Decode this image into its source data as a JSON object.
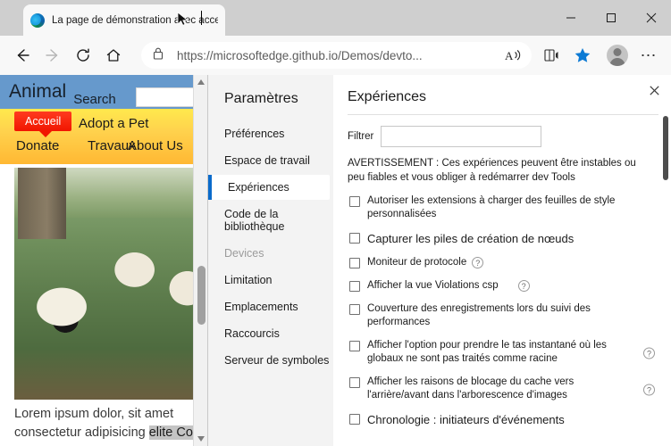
{
  "browser": {
    "tab": {
      "title": "La page de démonstration avec accessibilité est",
      "favicon": "edge-icon"
    },
    "window_controls": {
      "minimize": "–",
      "maximize": "□",
      "close": "✕"
    },
    "toolbar": {
      "back": "back-arrow-icon",
      "forward": "forward-arrow-icon",
      "refresh": "refresh-icon",
      "home": "home-icon",
      "lock": "lock-icon",
      "url": "https://microsoftedge.github.io/Demos/devto...",
      "url_domain": "microsoftedge.github.io",
      "url_path": "/Demos/devto...",
      "read_aloud": "read-aloud-icon",
      "immersive_reader": "immersive-reader-icon",
      "favorite": "star-icon",
      "profile": "avatar-icon",
      "settings": "ellipsis-icon",
      "star_color": "#0c7ad4"
    }
  },
  "webpage": {
    "logo": "Animal",
    "search_label": "Search",
    "search_value": "",
    "nav": {
      "adopt": "Adopt a Pet",
      "donate": "Donate",
      "travaux": "Travaux",
      "about": "About Us"
    },
    "tooltip": "Accueil",
    "photo_alt": "valais-blacknose-sheep-photo",
    "body_text_1": "Lorem ipsum dolor, sit amet",
    "body_text_2": "consectetur adipisicing ",
    "body_text_selected": "elite Co",
    "header_color": "#6699cc",
    "nav_color": "#ffd24d",
    "tooltip_color": "#f11500"
  },
  "devtools": {
    "sidebar": {
      "title": "Paramètres",
      "items": [
        {
          "label": "Préférences",
          "state": "normal"
        },
        {
          "label": "Espace de travail",
          "state": "normal"
        },
        {
          "label": "Expériences",
          "state": "selected"
        },
        {
          "label": "Code de la bibliothèque",
          "state": "normal"
        },
        {
          "label": "Devices",
          "state": "disabled"
        },
        {
          "label": "Limitation",
          "state": "normal"
        },
        {
          "label": "Emplacements",
          "state": "normal"
        },
        {
          "label": "Raccourcis",
          "state": "normal"
        },
        {
          "label": "Serveur de symboles",
          "state": "normal"
        }
      ]
    },
    "panel": {
      "close_icon": "close-icon",
      "heading": "Expériences",
      "filter_label": "Filtrer",
      "filter_value": "",
      "filter_placeholder": "",
      "warning": "AVERTISSEMENT : Ces expériences peuvent être instables ou peu fiables et vous obliger à redémarrer dev Tools",
      "experiments": [
        {
          "label": "Autoriser les extensions à charger des feuilles de style personnalisées",
          "checked": false,
          "help": false,
          "size": "normal"
        },
        {
          "label": "Capturer les piles de création de nœuds",
          "checked": false,
          "help": false,
          "size": "big"
        },
        {
          "label": "Moniteur de protocole",
          "checked": false,
          "help": true,
          "help_pos": "inline",
          "size": "normal"
        },
        {
          "label": "Afficher la vue Violations csp",
          "checked": false,
          "help": true,
          "help_pos": "inline-gap",
          "size": "normal"
        },
        {
          "label": "Couverture des enregistrements lors du suivi des performances",
          "checked": false,
          "help": false,
          "size": "normal"
        },
        {
          "label": "Afficher l'option pour prendre le tas instantané où les globaux ne sont pas traités comme racine",
          "checked": false,
          "help": true,
          "help_pos": "right",
          "size": "normal"
        },
        {
          "label": "Afficher les raisons de blocage du cache vers l'arrière/avant dans l'arborescence d'images",
          "checked": false,
          "help": true,
          "help_pos": "right",
          "size": "normal"
        },
        {
          "label": "Chronologie : initiateurs d'événements",
          "checked": false,
          "help": true,
          "help_pos": "inline",
          "size": "big"
        }
      ]
    },
    "accent_color": "#0b6bcb"
  }
}
